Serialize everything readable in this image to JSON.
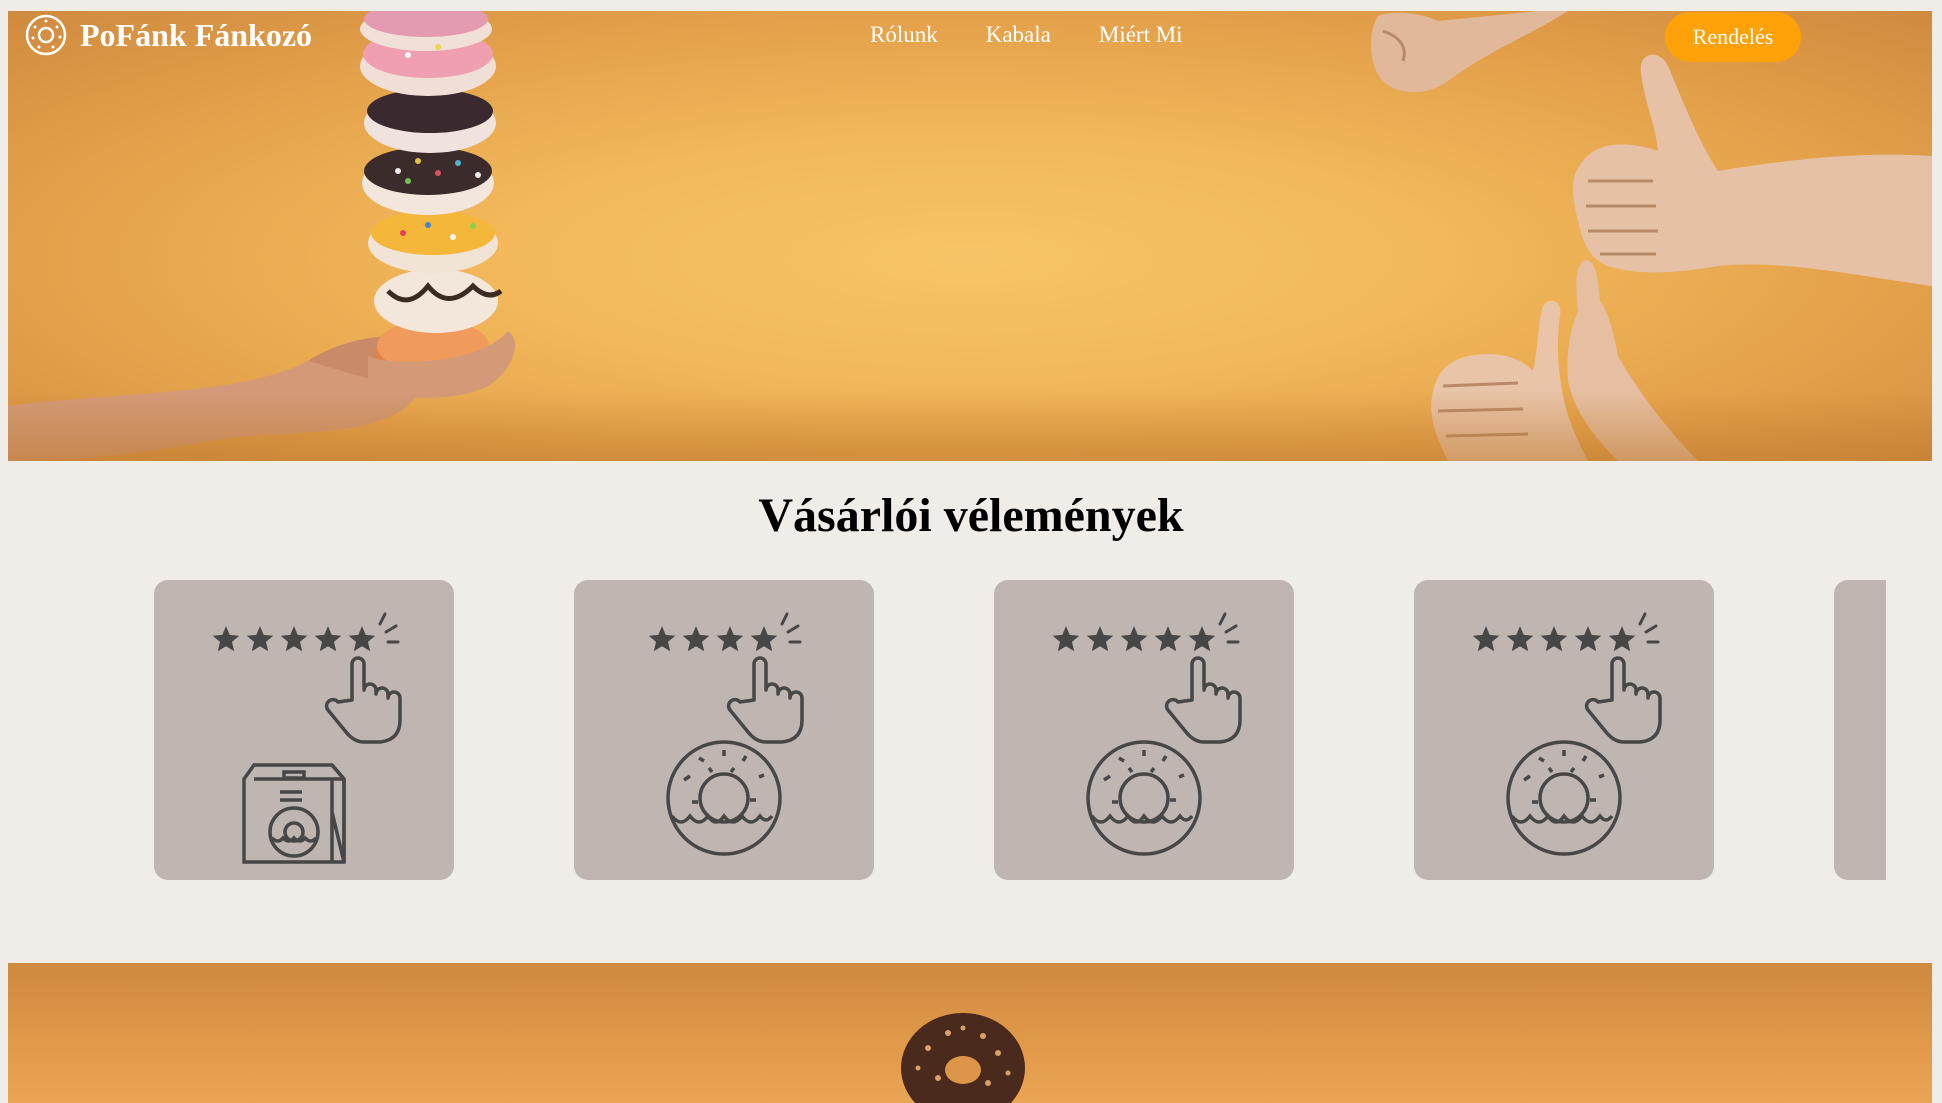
{
  "header": {
    "brand_name": "PoFánk Fánkozó",
    "nav": [
      "Rólunk",
      "Kabala",
      "Miért Mi"
    ],
    "order_button": "Rendelés"
  },
  "reviews": {
    "title": "Vásárlói vélemények",
    "cards": [
      {
        "stars": 5,
        "item_icon": "donut-bag-icon"
      },
      {
        "stars": 4,
        "item_icon": "donut-icon"
      },
      {
        "stars": 5,
        "item_icon": "donut-icon"
      },
      {
        "stars": 5,
        "item_icon": "donut-icon"
      },
      {
        "stars": 0,
        "item_icon": ""
      }
    ]
  },
  "colors": {
    "accent": "#ffa209",
    "card_bg": "#bfb6b1",
    "page_bg": "#f0ede8",
    "icon": "#474747"
  }
}
